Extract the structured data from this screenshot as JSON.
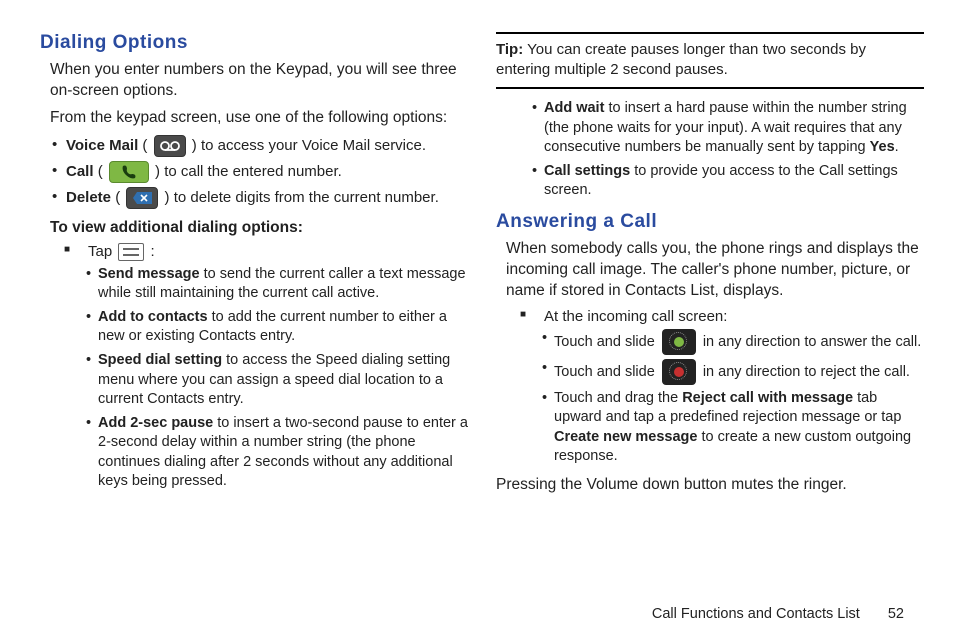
{
  "left": {
    "heading": "Dialing Options",
    "intro1": "When you enter numbers on the Keypad, you will see three on-screen options.",
    "intro2": "From the keypad screen, use one of the following options:",
    "opts": {
      "vm_label": "Voice Mail",
      "vm_after": " to access your Voice Mail service.",
      "call_label": "Call",
      "call_after": " to call the entered number.",
      "del_label": "Delete",
      "del_after": " to delete digits from the current number."
    },
    "sub_heading": "To view additional dialing options:",
    "tap_text": "Tap ",
    "tap_colon": " :",
    "subitems": {
      "sm_label": "Send message",
      "sm_after": " to send the current caller a text message while still maintaining the current call active.",
      "ac_label": "Add to contacts",
      "ac_after": " to add the current number to either a new or existing Contacts entry.",
      "sd_label": "Speed dial setting",
      "sd_after": " to access the Speed dialing setting menu where you can assign a speed dial location to a current Contacts entry.",
      "ap_label": "Add 2-sec pause",
      "ap_after": " to insert a two-second pause to enter a 2-second delay within a number string (the phone continues dialing after 2 seconds without any additional keys being pressed."
    }
  },
  "right": {
    "tip_label": "Tip:",
    "tip_text": " You can create pauses longer than two seconds by entering multiple 2 second pauses.",
    "cont_items": {
      "aw_label": "Add wait",
      "aw_after_a": " to insert a hard pause within the number string (the phone waits for your input). A wait requires that any consecutive numbers be manually sent by tapping ",
      "aw_yes": "Yes",
      "aw_after_b": ".",
      "cs_label": "Call settings",
      "cs_after": " to provide you access to the Call settings screen."
    },
    "heading2": "Answering a Call",
    "ans_intro": "When somebody calls you, the phone rings and displays the incoming call image. The caller's phone number, picture, or name if stored in Contacts List, displays.",
    "at_screen": "At the incoming call screen:",
    "ans_items": {
      "a1_before": "Touch and slide ",
      "a1_after": " in any direction to answer the call.",
      "a2_before": "Touch and slide ",
      "a2_after": " in any direction to reject the call.",
      "a3_before": "Touch and drag the ",
      "a3_bold1": "Reject call with message",
      "a3_mid": " tab upward and tap a predefined rejection message or tap ",
      "a3_bold2": "Create new message",
      "a3_after": " to create a new custom outgoing response."
    },
    "closing": "Pressing the Volume down button mutes the ringer."
  },
  "footer": {
    "chapter": "Call Functions and Contacts List",
    "page": "52"
  }
}
